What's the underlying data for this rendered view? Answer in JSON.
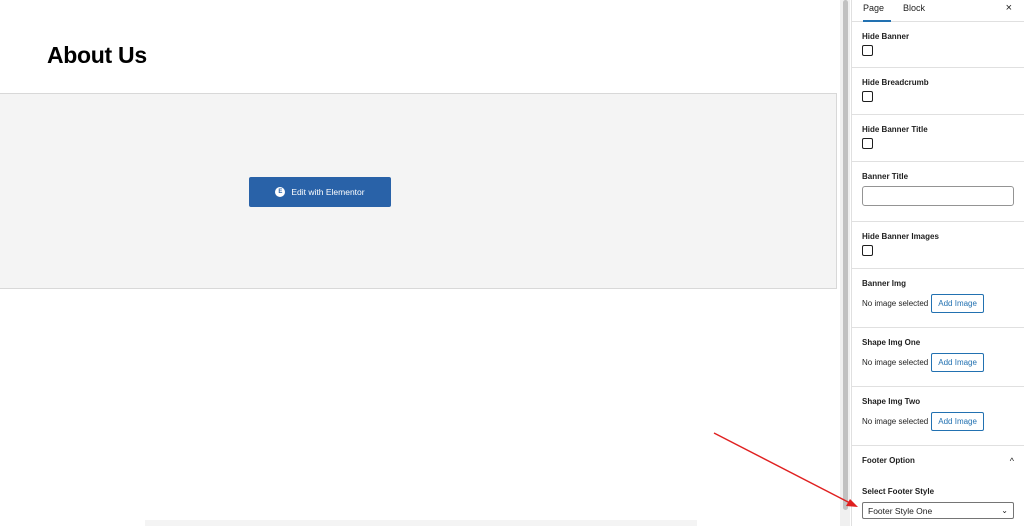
{
  "canvas": {
    "page_title": "About Us",
    "edit_button_label": "Edit with Elementor",
    "edit_button_icon_letter": "E",
    "edit_button_color": "#2962a8"
  },
  "sidebar": {
    "tabs": [
      {
        "label": "Page",
        "active": true
      },
      {
        "label": "Block",
        "active": false
      }
    ],
    "close_glyph": "×",
    "fields": {
      "hide_banner": {
        "label": "Hide Banner",
        "checked": false
      },
      "hide_breadcrumb": {
        "label": "Hide Breadcrumb",
        "checked": false
      },
      "hide_banner_title": {
        "label": "Hide Banner Title",
        "checked": false
      },
      "banner_title": {
        "label": "Banner Title",
        "value": ""
      },
      "hide_banner_images": {
        "label": "Hide Banner Images",
        "checked": false
      },
      "banner_img": {
        "label": "Banner Img",
        "status": "No image selected",
        "button": "Add Image"
      },
      "shape_img_one": {
        "label": "Shape Img One",
        "status": "No image selected",
        "button": "Add Image"
      },
      "shape_img_two": {
        "label": "Shape Img Two",
        "status": "No image selected",
        "button": "Add Image"
      }
    },
    "footer_option": {
      "title": "Footer Option",
      "chevron": "^",
      "select_label": "Select Footer Style",
      "selected_value": "Footer Style One"
    }
  },
  "colors": {
    "accent": "#2271b1",
    "annotation_arrow": "#e02020"
  }
}
